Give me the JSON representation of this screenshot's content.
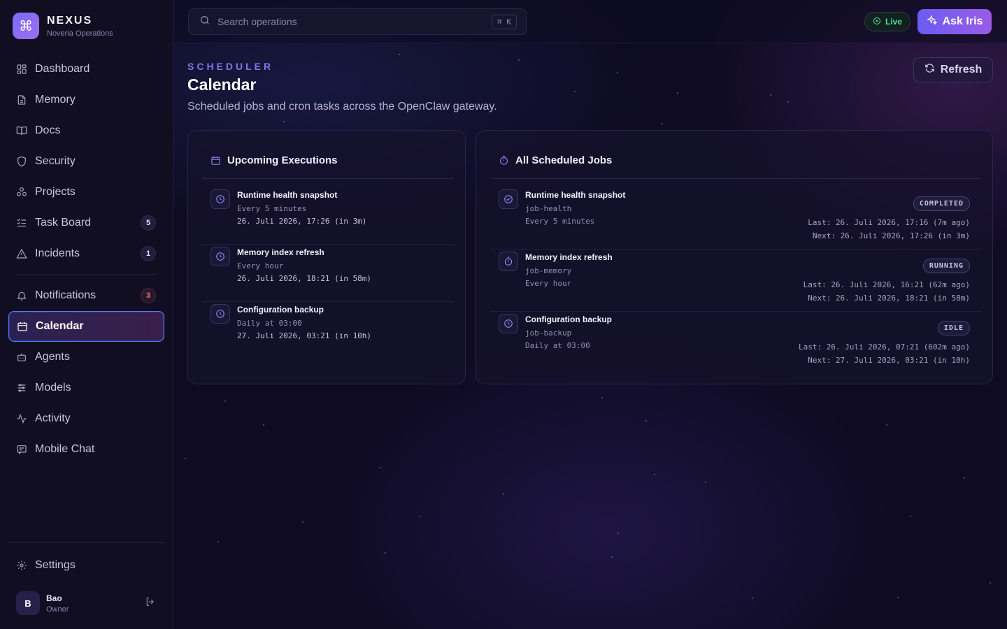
{
  "brand": {
    "name": "NEXUS",
    "subtitle": "Noveria Operations"
  },
  "nav": {
    "items": [
      {
        "label": "Dashboard",
        "icon": "grid-icon"
      },
      {
        "label": "Memory",
        "icon": "document-icon"
      },
      {
        "label": "Docs",
        "icon": "book-icon"
      },
      {
        "label": "Security",
        "icon": "shield-icon"
      },
      {
        "label": "Projects",
        "icon": "nodes-icon"
      },
      {
        "label": "Task Board",
        "icon": "checklist-icon",
        "badge": "5"
      },
      {
        "label": "Incidents",
        "icon": "warning-icon",
        "badge": "1"
      },
      {
        "label": "Notifications",
        "icon": "bell-icon",
        "badge": "3"
      },
      {
        "label": "Calendar",
        "icon": "calendar-icon",
        "active": true
      },
      {
        "label": "Agents",
        "icon": "bot-icon"
      },
      {
        "label": "Models",
        "icon": "sliders-icon"
      },
      {
        "label": "Activity",
        "icon": "pulse-icon"
      },
      {
        "label": "Mobile Chat",
        "icon": "chat-icon"
      }
    ],
    "settings_label": "Settings"
  },
  "user": {
    "initial": "B",
    "name": "Bao",
    "role": "Owner"
  },
  "topbar": {
    "search_placeholder": "Search operations",
    "shortcut": "⌘ K",
    "live_label": "Live",
    "ask_label": "Ask Iris"
  },
  "page": {
    "eyebrow": "SCHEDULER",
    "title": "Calendar",
    "description": "Scheduled jobs and cron tasks across the OpenClaw gateway.",
    "refresh_label": "Refresh"
  },
  "upcoming": {
    "title": "Upcoming Executions",
    "items": [
      {
        "name": "Runtime health snapshot",
        "schedule": "Every 5 minutes",
        "next": "26. Juli 2026, 17:26 (in 3m)"
      },
      {
        "name": "Memory index refresh",
        "schedule": "Every hour",
        "next": "26. Juli 2026, 18:21 (in 58m)"
      },
      {
        "name": "Configuration backup",
        "schedule": "Daily at 03:00",
        "next": "27. Juli 2026, 03:21 (in 10h)"
      }
    ]
  },
  "jobs": {
    "title": "All Scheduled Jobs",
    "items": [
      {
        "name": "Runtime health snapshot",
        "id": "job-health",
        "schedule": "Every 5 minutes",
        "status": "COMPLETED",
        "last": "Last: 26. Juli 2026, 17:16 (7m ago)",
        "next": "Next: 26. Juli 2026, 17:26 (in 3m)"
      },
      {
        "name": "Memory index refresh",
        "id": "job-memory",
        "schedule": "Every hour",
        "status": "RUNNING",
        "last": "Last: 26. Juli 2026, 16:21 (62m ago)",
        "next": "Next: 26. Juli 2026, 18:21 (in 58m)"
      },
      {
        "name": "Configuration backup",
        "id": "job-backup",
        "schedule": "Daily at 03:00",
        "status": "IDLE",
        "last": "Last: 26. Juli 2026, 07:21 (602m ago)",
        "next": "Next: 27. Juli 2026, 03:21 (in 10h)"
      }
    ]
  }
}
